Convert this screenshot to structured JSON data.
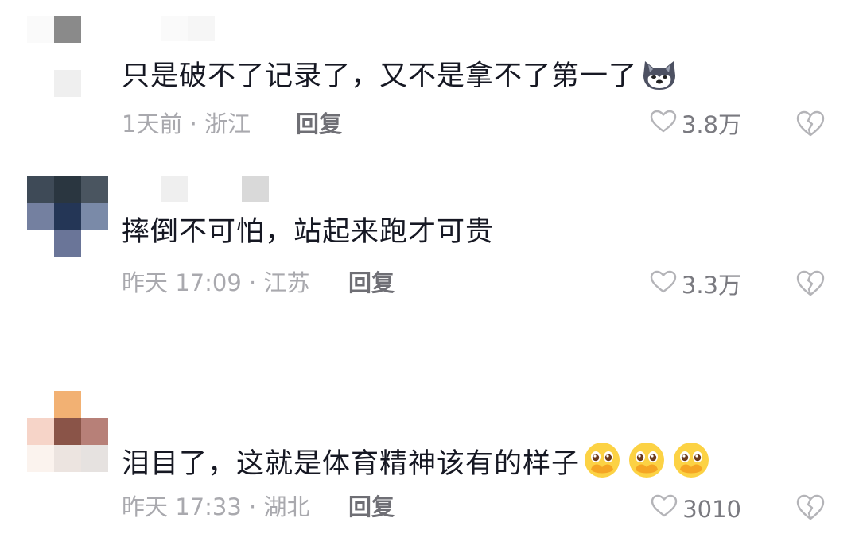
{
  "comments": [
    {
      "text": "只是破不了记录了，又不是拿不了第一了",
      "emoji": "dog-face-emoji",
      "time_location": "1天前 · 浙江",
      "reply_label": "回复",
      "like_count": "3.8万"
    },
    {
      "text": "摔倒不可怕，站起来跑才可贵",
      "time_location": "昨天 17:09 · 江苏",
      "reply_label": "回复",
      "like_count": "3.3万"
    },
    {
      "text": "泪目了，这就是体育精神该有的样子",
      "emoji": "pleading-face-hands-emoji",
      "time_location": "昨天 17:33 · 湖北",
      "reply_label": "回复",
      "like_count": "3010"
    }
  ],
  "icons": {
    "like": "heart-outline-icon",
    "dislike": "broken-heart-icon"
  },
  "colors": {
    "text": "#161823",
    "meta": "#a9a9ae",
    "reply": "#6f6f75",
    "icon": "#b4b4b8"
  }
}
